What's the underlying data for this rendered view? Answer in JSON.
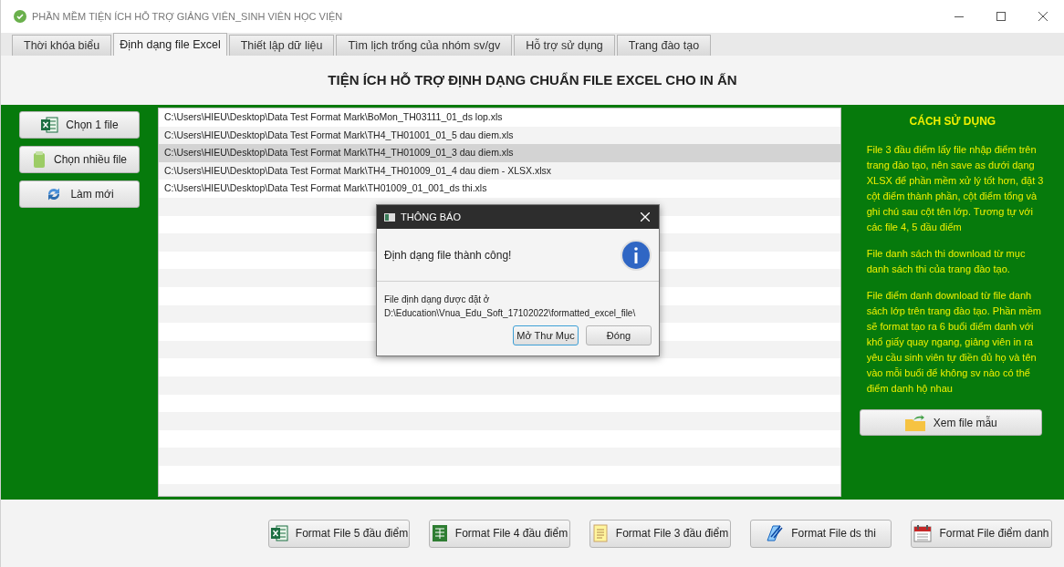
{
  "window": {
    "title": "PHẦN MỀM TIỆN ÍCH HỖ TRỢ GIẢNG VIÊN_SINH VIÊN HỌC VIỆN"
  },
  "tabs": [
    {
      "label": "Thời khóa biểu",
      "selected": false
    },
    {
      "label": "Định dạng file Excel",
      "selected": true
    },
    {
      "label": "Thiết lập dữ liệu",
      "selected": false
    },
    {
      "label": "Tìm lịch trống của nhóm sv/gv",
      "selected": false
    },
    {
      "label": "Hỗ trợ sử dụng",
      "selected": false
    },
    {
      "label": "Trang đào tạo",
      "selected": false
    }
  ],
  "heading": "TIỆN ÍCH HỖ TRỢ ĐỊNH DẠNG CHUẨN FILE EXCEL CHO IN ẤN",
  "side_buttons": [
    {
      "label": "Chọn 1 file",
      "kind": "excel"
    },
    {
      "label": "Chọn nhiều file",
      "kind": "multi"
    },
    {
      "label": "Làm mới",
      "kind": "refresh"
    }
  ],
  "files": [
    {
      "path": "C:\\Users\\HIEU\\Desktop\\Data Test Format Mark\\BoMon_TH03111_01_ds lop.xls",
      "selected": false
    },
    {
      "path": "C:\\Users\\HIEU\\Desktop\\Data Test Format Mark\\TH4_TH01001_01_5 dau diem.xls",
      "selected": false
    },
    {
      "path": "C:\\Users\\HIEU\\Desktop\\Data Test Format Mark\\TH4_TH01009_01_3 dau diem.xls",
      "selected": true
    },
    {
      "path": "C:\\Users\\HIEU\\Desktop\\Data Test Format Mark\\TH4_TH01009_01_4 dau diem - XLSX.xlsx",
      "selected": false
    },
    {
      "path": "C:\\Users\\HIEU\\Desktop\\Data Test Format Mark\\TH01009_01_001_ds thi.xls",
      "selected": false
    }
  ],
  "usage": {
    "title": "CÁCH SỬ DỤNG",
    "paragraphs": [
      "File 3 đầu điểm lấy file nhập điểm trên trang đào tạo, nên save as dưới dạng XLSX để phần mềm xử lý tốt hơn, đặt 3 cột điểm thành phần, cột điểm tổng và ghi chú sau cột tên lớp. Tương tự với các file 4, 5 đầu điểm",
      "File danh sách thi download từ mục danh sách thi của trang đào tạo.",
      "File điểm danh download từ file danh sách lớp trên trang đào tạo. Phần mềm sẽ format tạo ra 6 buổi điểm danh với khổ giấy quay ngang, giảng viên in ra yêu cầu sinh viên tự điền đủ họ và tên vào mỗi buổi để không sv nào có thể điểm danh hộ nhau"
    ],
    "button": "Xem file mẫu"
  },
  "dialog": {
    "title": "THÔNG BÁO",
    "message": "Định dạng file thành công!",
    "detail_label": "File định dạng được đặt ở",
    "detail_path": "D:\\Education\\Vnua_Edu_Soft_17102022\\formatted_excel_file\\",
    "buttons": [
      {
        "label": "Mở Thư Mục",
        "selected": true
      },
      {
        "label": "Đóng",
        "selected": false
      }
    ]
  },
  "format_buttons": [
    {
      "label": "Format File 5 đầu điểm",
      "kind": "excel-green"
    },
    {
      "label": "Format File 4 đầu điểm",
      "kind": "sheet"
    },
    {
      "label": "Format File 3 đầu điểm",
      "kind": "note"
    },
    {
      "label": "Format File ds thi",
      "kind": "pen"
    },
    {
      "label": "Format File điểm danh",
      "kind": "calendar"
    }
  ]
}
